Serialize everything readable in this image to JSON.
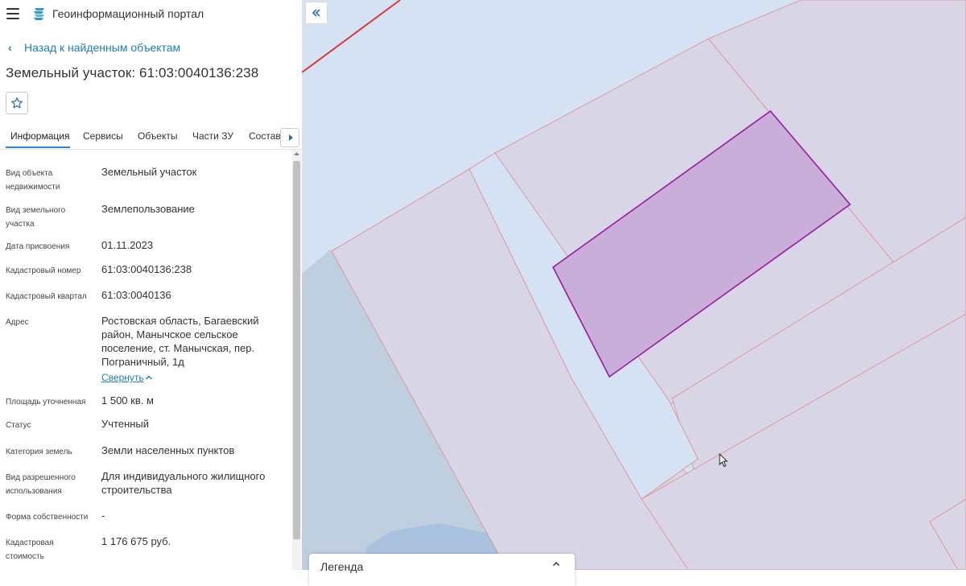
{
  "app": {
    "title": "Геоинформационный портал"
  },
  "nav": {
    "back_label": "Назад к найденным объектам"
  },
  "object": {
    "title": "Земельный участок: 61:03:0040136:238"
  },
  "tabs": [
    {
      "label": "Информация",
      "active": true
    },
    {
      "label": "Сервисы",
      "active": false
    },
    {
      "label": "Объекты",
      "active": false
    },
    {
      "label": "Части ЗУ",
      "active": false
    },
    {
      "label": "Состав",
      "active": false
    }
  ],
  "info": [
    {
      "key": "Вид объекта недвижимости",
      "value": "Земельный участок"
    },
    {
      "key": "Вид земельного участка",
      "value": "Землепользование"
    },
    {
      "key": "Дата присвоения",
      "value": "01.11.2023"
    },
    {
      "key": "Кадастровый номер",
      "value": "61:03:0040136:238"
    },
    {
      "key": "Кадастровый квартал",
      "value": "61:03:0040136"
    },
    {
      "key": "Адрес",
      "value": "Ростовская область, Багаевский район, Манычское сельское поселение, ст. Манычская, пер. Пограничный, 1д"
    },
    {
      "key": "Площадь уточненная",
      "value": "1 500 кв. м"
    },
    {
      "key": "Статус",
      "value": "Учтенный"
    },
    {
      "key": "Категория земель",
      "value": "Земли населенных пунктов"
    },
    {
      "key": "Вид разрешенного использования",
      "value": "Для индивидуального жилищного строительства"
    },
    {
      "key": "Форма собственности",
      "value": "-"
    },
    {
      "key": "Кадастровая стоимость",
      "value": "1 176 675 руб."
    }
  ],
  "address_toggle": {
    "label": "Свернуть"
  },
  "legend": {
    "title": "Легенда"
  },
  "colors": {
    "accent": "#1a7fb8",
    "map_background": "#d5e2f3",
    "parcel_fill": "#d8d6e6",
    "parcel_stroke": "#e28a8a",
    "selected_fill": "#c8aed8",
    "selected_stroke": "#9a1aa6",
    "boundary_line": "#d83a3a"
  }
}
